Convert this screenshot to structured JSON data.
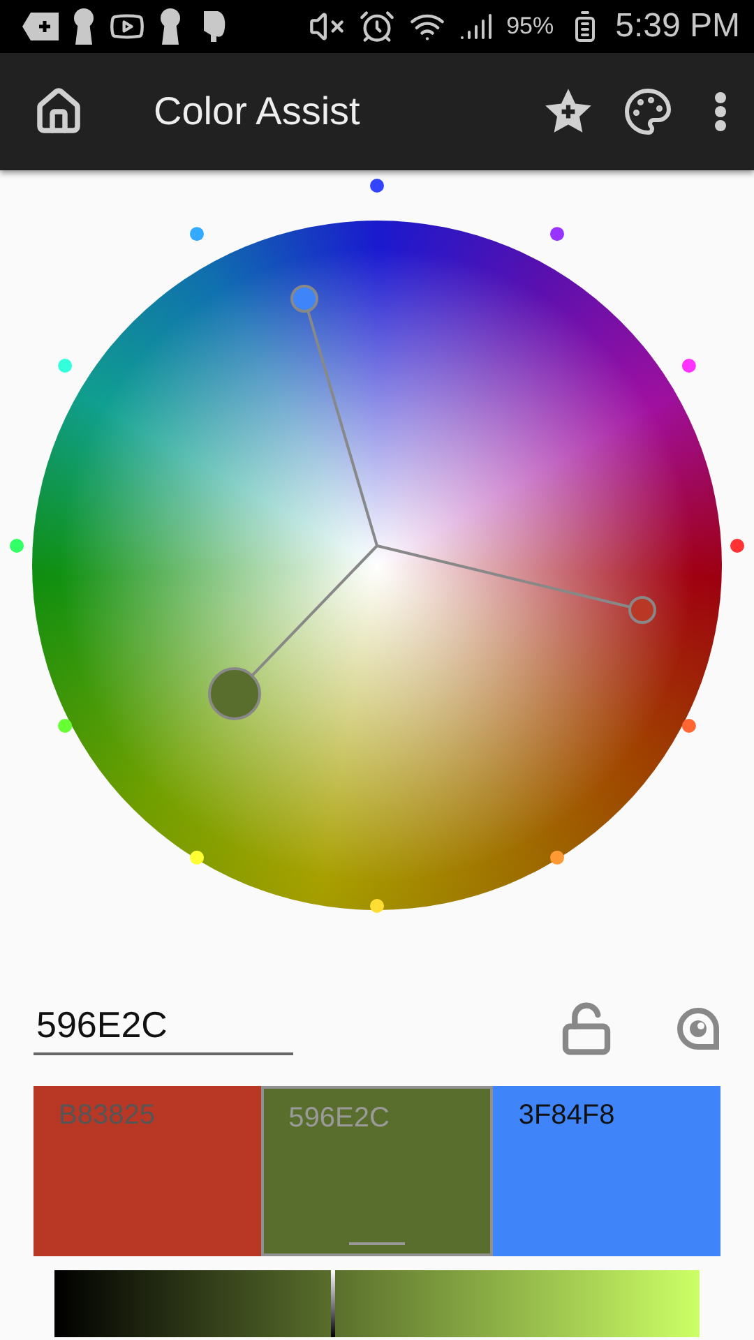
{
  "status_bar": {
    "battery": "95%",
    "time": "5:39 PM"
  },
  "app_bar": {
    "title": "Color Assist"
  },
  "hex_field": {
    "value": "596E2C"
  },
  "lock": {
    "locked": false
  },
  "swatches": [
    {
      "hex": "B83825",
      "color": "#b83825",
      "selected": false
    },
    {
      "hex": "596E2C",
      "color": "#596e2c",
      "selected": true
    },
    {
      "hex": "3F84F8",
      "color": "#3f84f8",
      "selected": false
    }
  ],
  "shade_slider": {
    "level": 0.43
  }
}
